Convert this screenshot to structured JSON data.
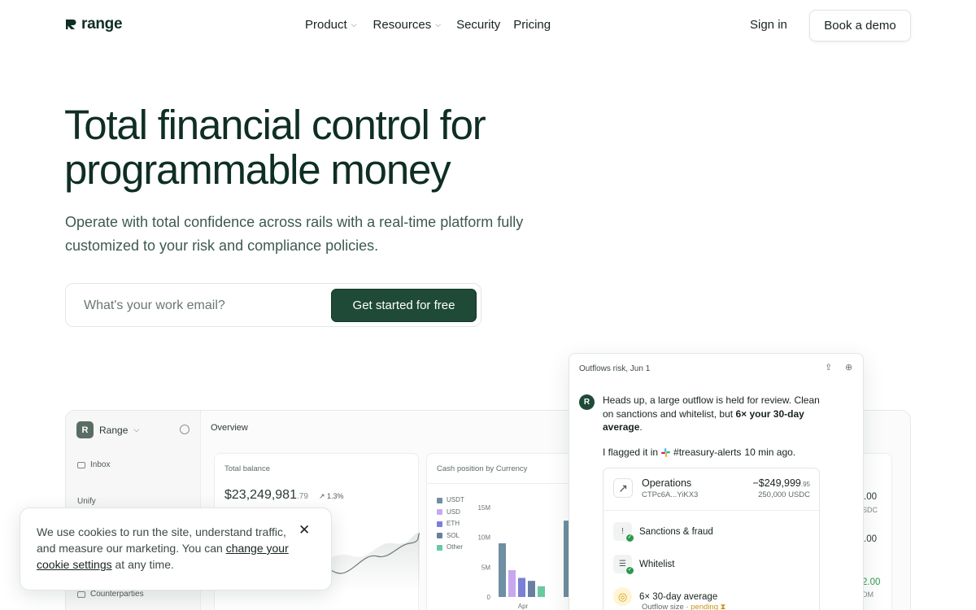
{
  "nav": {
    "brand": "range",
    "links": [
      {
        "label": "Product",
        "dropdown": true
      },
      {
        "label": "Resources",
        "dropdown": true
      },
      {
        "label": "Security",
        "dropdown": false
      },
      {
        "label": "Pricing",
        "dropdown": false
      }
    ],
    "sign_in": "Sign in",
    "demo": "Book a demo"
  },
  "hero": {
    "title": "Total financial control for programmable money",
    "subtitle": "Operate with total confidence across rails with a real-time platform fully customized to your risk and compliance policies.",
    "email_placeholder": "What's your work email?",
    "cta": "Get started for free"
  },
  "dashboard": {
    "workspace": "Range",
    "sidebar": [
      "Inbox",
      "Unify",
      "Counterparties"
    ],
    "page_title": "Overview",
    "balance_card": {
      "label": "Total balance",
      "amount": "$23,249,981",
      "cents": ".79",
      "change": "↗ 1.3%"
    },
    "cash_card": {
      "label": "Cash position by Currency",
      "legend": [
        {
          "name": "USDT",
          "color": "#6f8fa3"
        },
        {
          "name": "USD",
          "color": "#c7a8ef"
        },
        {
          "name": "ETH",
          "color": "#7a80d8"
        },
        {
          "name": "SOL",
          "color": "#6a7fa0"
        },
        {
          "name": "Other",
          "color": "#69c9a2"
        }
      ],
      "y_ticks": [
        "15M",
        "10M",
        "5M",
        "0"
      ],
      "x_tick": "Apr",
      "bars_millions": [
        9,
        4.5,
        3.2,
        2.7,
        1.8,
        12.8
      ]
    },
    "right_values": [
      ".00",
      "SDC",
      ".00",
      "2.00",
      "DM"
    ]
  },
  "panel": {
    "title": "Outflows risk, Jun 1",
    "message_part1": "Heads up, a large outflow is held for review. Clean on sanctions and whitelist, but ",
    "message_bold": "6× your 30-day average",
    "message_end": ".",
    "flag_prefix": "I flagged it in",
    "channel": "#treasury-alerts",
    "flag_suffix": "10 min ago.",
    "operation": {
      "name": "Operations",
      "id": "CTPc6A...YiKX3",
      "amount": "−$249,999",
      "amount_cents": ".95",
      "sub": "250,000 USDC"
    },
    "checks": [
      "Sanctions & fraud",
      "Whitelist",
      "6× 30-day average"
    ],
    "outflow_label": "Outflow size · ",
    "outflow_status": "pending"
  },
  "cookie": {
    "text": "We use cookies to run the site, understand traffic, and measure our marketing. You can ",
    "link": "change your cookie settings",
    "suffix": " at any time."
  }
}
